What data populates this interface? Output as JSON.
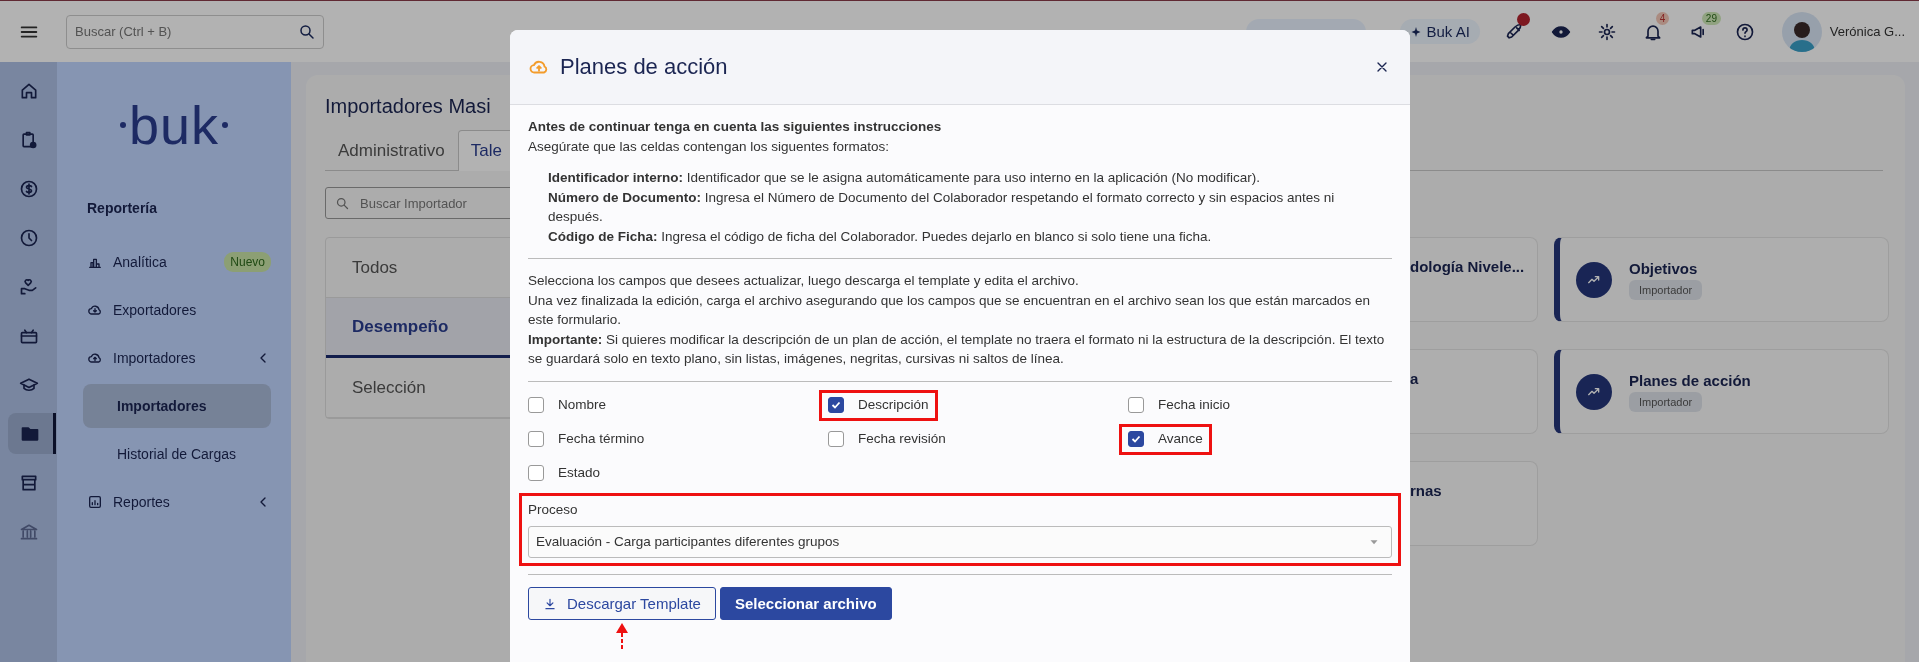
{
  "topbar": {
    "search_placeholder": "Buscar (Ctrl + B)",
    "ai_label": "Buk AI",
    "notifications_badge": "4",
    "news_badge": "29",
    "user_name": "Verónica G..."
  },
  "rail": [
    {
      "selected": false
    },
    {
      "selected": false
    },
    {
      "selected": false
    },
    {
      "selected": false
    },
    {
      "selected": false
    },
    {
      "selected": false
    },
    {
      "selected": false
    },
    {
      "selected": true
    },
    {
      "selected": false
    },
    {
      "selected": false
    }
  ],
  "sidebar": {
    "logo": "buk",
    "section_title": "Reportería",
    "items": [
      {
        "label": "Analítica",
        "badge": "Nuevo",
        "chevron": false
      },
      {
        "label": "Exportadores",
        "chevron": false
      },
      {
        "label": "Importadores",
        "chevron": true,
        "children": [
          {
            "label": "Importadores",
            "selected": true
          },
          {
            "label": "Historial de Cargas",
            "selected": false
          }
        ]
      },
      {
        "label": "Reportes",
        "chevron": true
      }
    ]
  },
  "content": {
    "title": "Importadores Masi",
    "tabs": [
      {
        "label": "Administrativo",
        "selected": false
      },
      {
        "label": "Tale",
        "selected": true
      }
    ],
    "search_placeholder": "Buscar Importador",
    "categories": [
      {
        "label": "Todos",
        "selected": false
      },
      {
        "label": "Desempeño",
        "selected": true
      },
      {
        "label": "Selección",
        "selected": false
      }
    ],
    "cards": [
      {
        "kind": "cut",
        "title": "dología Nivele..."
      },
      {
        "kind": "full",
        "title": "Objetivos",
        "tag": "Importador"
      },
      {
        "kind": "cut",
        "title": "a"
      },
      {
        "kind": "full",
        "title": "Planes de acción",
        "tag": "Importador"
      },
      {
        "kind": "cut",
        "title": "rnas"
      }
    ]
  },
  "modal": {
    "title": "Planes de acción",
    "intro_title": "Antes de continuar tenga en cuenta las siguientes instrucciones",
    "intro_text": "Asegúrate que las celdas contengan los siguentes formatos:",
    "formats": [
      "**Identificador interno:** Identificador que se le asigna automáticamente para uso interno en la aplicación (No modificar).",
      "**Número de Documento:** Ingresa el Número de Documento del Colaborador respetando el formato correcto y sin espacios antes ni después.",
      "**Código de Ficha:** Ingresa el código de ficha del Colaborador. Puedes dejarlo en blanco si solo tiene una ficha."
    ],
    "instructions": [
      "Selecciona los campos que desees actualizar, luego descarga el template y edita el archivo.",
      "Una vez finalizada la edición, carga el archivo asegurando que los campos que se encuentran en el archivo sean los que están marcados en este formulario.",
      "**Importante:** Si quieres modificar la descripción de un plan de acción, el template no traera el formato ni la estructura de la descripción. El texto se guardará solo en texto plano, sin listas, imágenes, negritas, cursivas ni saltos de línea."
    ],
    "fields": [
      {
        "label": "Nombre",
        "checked": false,
        "highlighted": false
      },
      {
        "label": "Descripción",
        "checked": true,
        "highlighted": true
      },
      {
        "label": "Fecha inicio",
        "checked": false,
        "highlighted": false
      },
      {
        "label": "Fecha término",
        "checked": false,
        "highlighted": false
      },
      {
        "label": "Fecha revisión",
        "checked": false,
        "highlighted": false
      },
      {
        "label": "Avance",
        "checked": true,
        "highlighted": true
      },
      {
        "label": "Estado",
        "checked": false,
        "highlighted": false
      }
    ],
    "process": {
      "label": "Proceso",
      "value": "Evaluación - Carga participantes diferentes grupos",
      "highlighted": true
    },
    "buttons": [
      {
        "kind": "outline",
        "label": "Descargar Template",
        "pointed": true
      },
      {
        "kind": "primary",
        "label": "Seleccionar archivo",
        "pointed": false
      }
    ]
  }
}
